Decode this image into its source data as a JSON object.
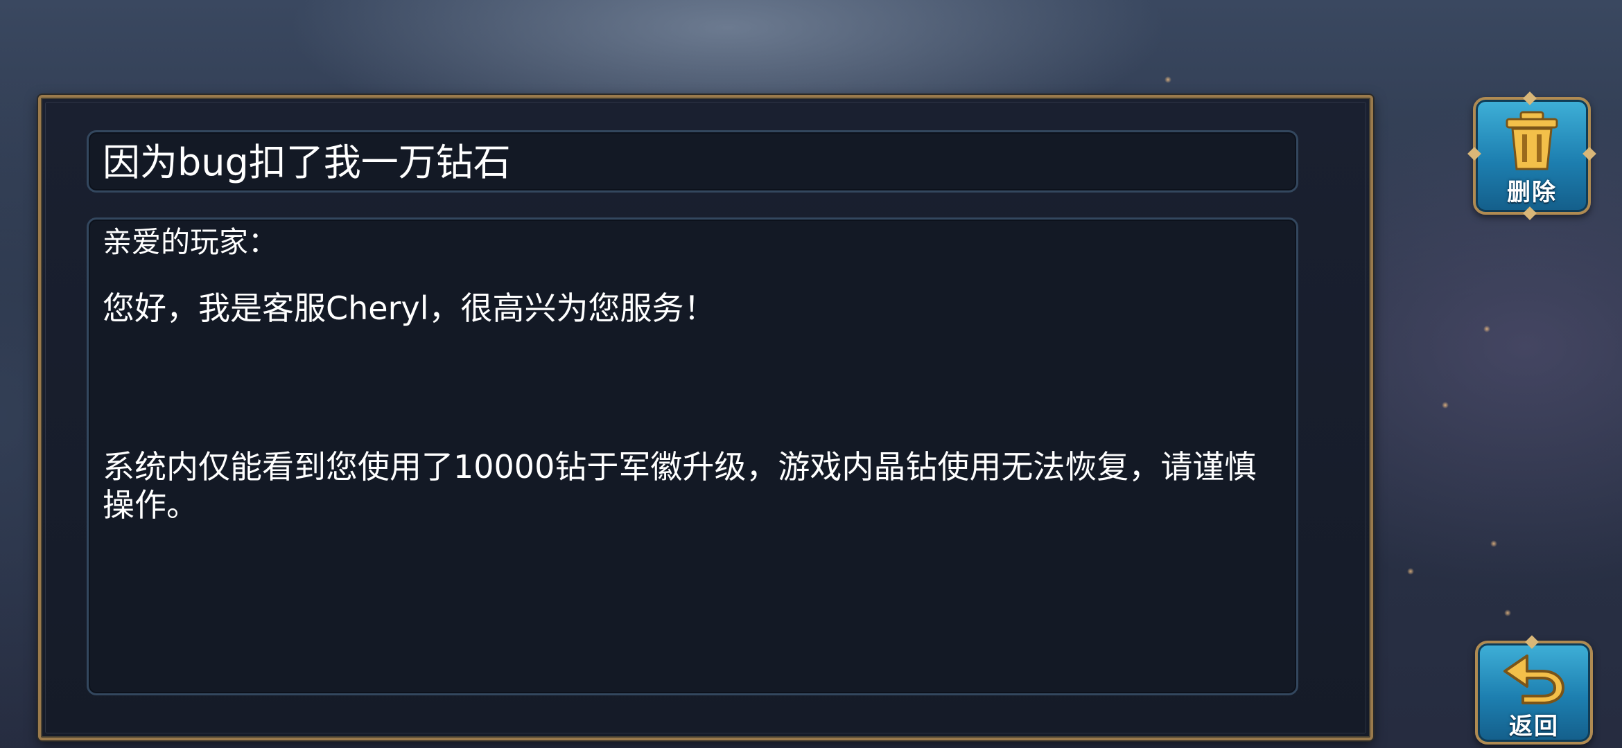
{
  "mail": {
    "title": "因为bug扣了我一万钻石",
    "greeting": "亲爱的玩家：",
    "intro": "您好，我是客服Cheryl，很高兴为您服务！",
    "message": "系统内仅能看到您使用了10000钻于军徽升级，游戏内晶钻使用无法恢复，请谨慎操作。"
  },
  "buttons": {
    "delete_label": "删除",
    "back_label": "返回"
  },
  "icons": {
    "delete": "trash-can-icon",
    "back": "return-arrow-icon"
  },
  "colors": {
    "panel_border": "#9a7a4c",
    "box_border": "#33475e",
    "button_blue": "#1d7fb0",
    "button_gold": "#b08b52"
  }
}
